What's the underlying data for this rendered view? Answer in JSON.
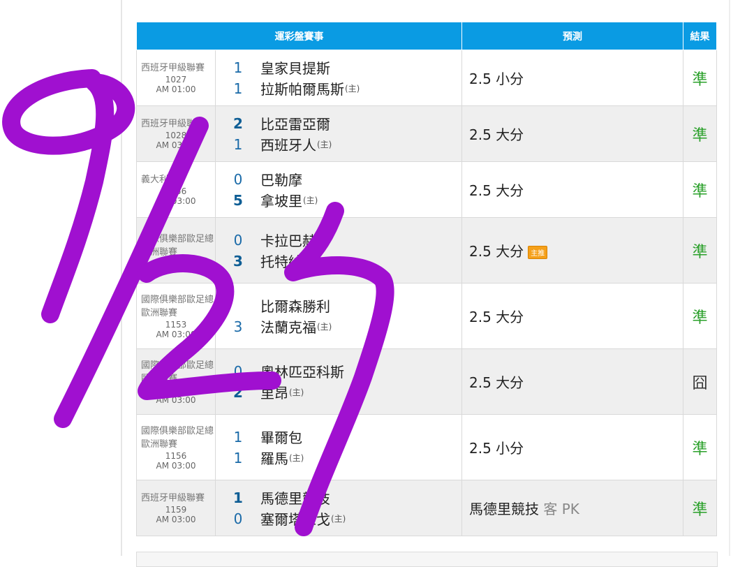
{
  "table": {
    "headers": {
      "matches": "運彩盤賽事",
      "prediction": "預測",
      "result": "結果"
    },
    "rows": [
      {
        "league": "西班牙甲級聯賽",
        "number": "1027",
        "time": "AM 01:00",
        "away_score": "1",
        "away_team": "皇家貝提斯",
        "home_score": "1",
        "home_team": "拉斯帕爾馬斯",
        "home_tag": "(主)",
        "prediction": "2.5 小分",
        "prediction_suffix": "",
        "badge": "",
        "result": "準",
        "result_status": "hit",
        "winner": "none"
      },
      {
        "league": "西班牙甲級聯賽",
        "number": "1028",
        "time": "AM 03:00",
        "away_score": "2",
        "away_team": "比亞雷亞爾",
        "home_score": "1",
        "home_team": "西班牙人",
        "home_tag": "(主)",
        "prediction": "2.5 大分",
        "prediction_suffix": "",
        "badge": "",
        "result": "準",
        "result_status": "hit",
        "winner": "away"
      },
      {
        "league": "義大利盃",
        "number": "1056",
        "time": "AM 03:00",
        "away_score": "0",
        "away_team": "巴勒摩",
        "home_score": "5",
        "home_team": "拿坡里",
        "home_tag": "(主)",
        "prediction": "2.5 大分",
        "prediction_suffix": "",
        "badge": "",
        "result": "準",
        "result_status": "hit",
        "winner": "home"
      },
      {
        "league": "國際俱樂部歐足總歐洲聯賽",
        "number": "1143",
        "time": "",
        "away_score": "0",
        "away_team": "卡拉巴赫",
        "home_score": "3",
        "home_team": "托特納姆",
        "home_tag": "",
        "prediction": "2.5 大分",
        "prediction_suffix": "",
        "badge": "主推",
        "result": "準",
        "result_status": "hit",
        "winner": "home"
      },
      {
        "league": "國際俱樂部歐足總歐洲聯賽",
        "number": "1153",
        "time": "AM 03:00",
        "away_score": "",
        "away_team": "比爾森勝利",
        "home_score": "3",
        "home_team": "法蘭克福",
        "home_tag": "(主)",
        "prediction": "2.5 大分",
        "prediction_suffix": "",
        "badge": "",
        "result": "準",
        "result_status": "hit",
        "winner": "none"
      },
      {
        "league": "國際俱樂部歐足總歐洲聯賽",
        "number": "1154",
        "time": "AM 03:00",
        "away_score": "0",
        "away_team": "奧林匹亞科斯",
        "home_score": "2",
        "home_team": "里昂",
        "home_tag": "(主)",
        "prediction": "2.5 大分",
        "prediction_suffix": "",
        "badge": "",
        "result": "囧",
        "result_status": "miss",
        "winner": "home"
      },
      {
        "league": "國際俱樂部歐足總歐洲聯賽",
        "number": "1156",
        "time": "AM 03:00",
        "away_score": "1",
        "away_team": "畢爾包",
        "home_score": "1",
        "home_team": "羅馬",
        "home_tag": "(主)",
        "prediction": "2.5 小分",
        "prediction_suffix": "",
        "badge": "",
        "result": "準",
        "result_status": "hit",
        "winner": "none"
      },
      {
        "league": "西班牙甲級聯賽",
        "number": "1159",
        "time": "AM 03:00",
        "away_score": "1",
        "away_team": "馬德里競技",
        "home_score": "0",
        "home_team": "塞爾塔維戈",
        "home_tag": "(主)",
        "prediction": "馬德里競技",
        "prediction_suffix": "客 PK",
        "badge": "",
        "result": "準",
        "result_status": "hit",
        "winner": "away"
      }
    ]
  },
  "annotation": {
    "text": "9/27",
    "color": "#a010d0"
  }
}
